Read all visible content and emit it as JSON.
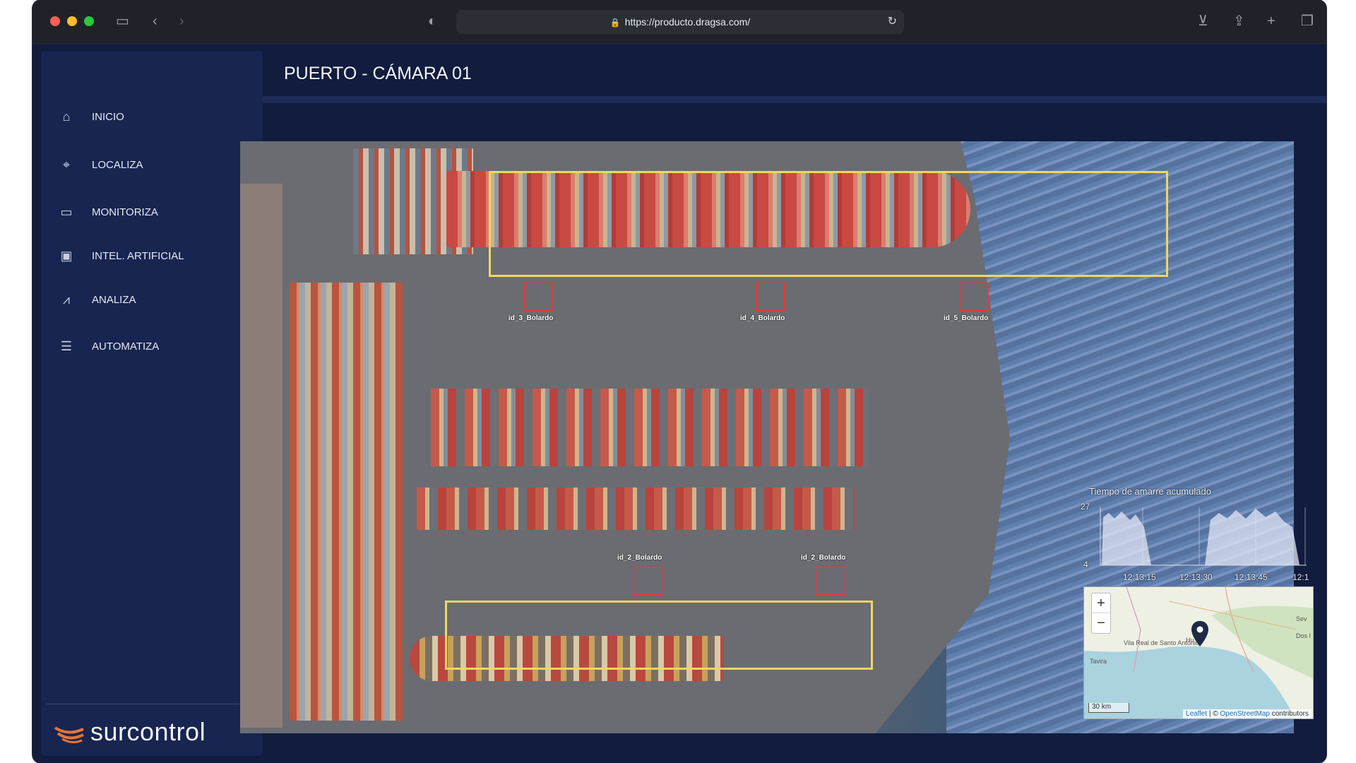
{
  "browser": {
    "url": "https://producto.dragsa.com/"
  },
  "sidebar": {
    "items": [
      {
        "label": "INICIO",
        "icon": "home-icon"
      },
      {
        "label": "LOCALIZA",
        "icon": "map-pin-icon"
      },
      {
        "label": "MONITORIZA",
        "icon": "monitor-icon"
      },
      {
        "label": "INTEL. ARTIFICIAL",
        "icon": "ai-chip-icon"
      },
      {
        "label": "ANALIZA",
        "icon": "chart-icon"
      },
      {
        "label": "AUTOMATIZA",
        "icon": "checklist-icon"
      }
    ],
    "brand": "surcontrol"
  },
  "header": {
    "title": "PUERTO - CÁMARA 01"
  },
  "camera": {
    "detections": [
      {
        "label": "id_3_Bolardo"
      },
      {
        "label": "id_4_Bolardo"
      },
      {
        "label": "id_5_Bolardo"
      },
      {
        "label": "id_2_Bolardo"
      },
      {
        "label": "id_2_Bolardo"
      }
    ]
  },
  "mooring_chart": {
    "title": "Tiempo de amarre acumulado",
    "y_max_label": "27",
    "y_min_label": "4",
    "x_ticks": [
      "12:13:15",
      "12:13:30",
      "12:13:45",
      "12:1"
    ]
  },
  "map": {
    "zoom_in": "+",
    "zoom_out": "−",
    "scale": "30 km",
    "attribution_leaflet": "Leaflet",
    "attribution_sep": " | © ",
    "attribution_osm": "OpenStreetMap",
    "attribution_tail": " contributors",
    "places": [
      "Vila Real de Santo António",
      "Tavira",
      "Hu",
      "Sev",
      "Dos I"
    ]
  },
  "colors": {
    "detection_ship": "#f1d75c",
    "detection_bollard": "#e43a3a",
    "sidebar_bg": "#172550",
    "page_bg": "#111c3e"
  }
}
